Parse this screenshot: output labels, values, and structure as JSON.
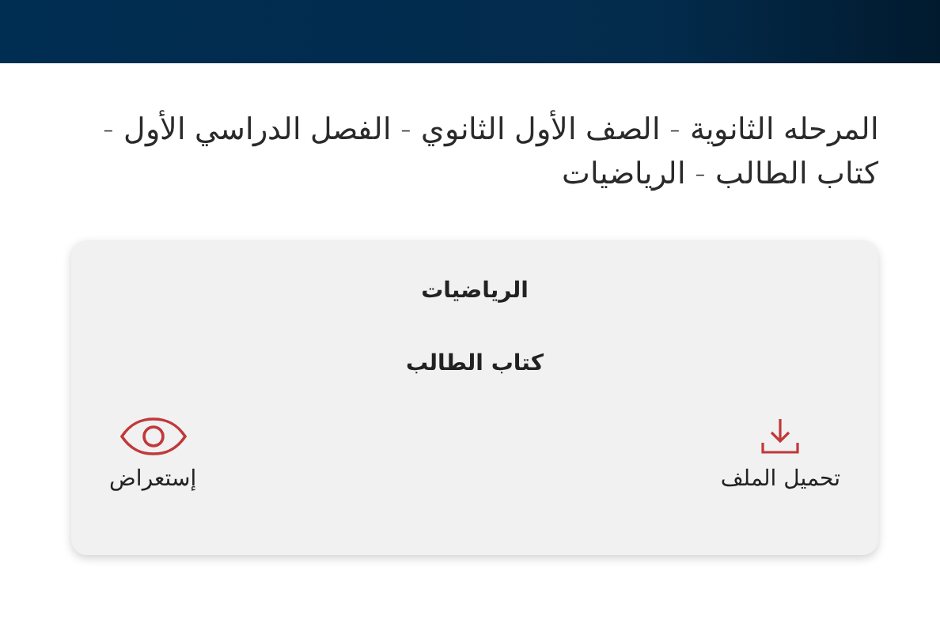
{
  "title": "المرحله الثانوية - الصف الأول الثانوي - الفصل الدراسي الأول - كتاب الطالب - الرياضيات",
  "card": {
    "subject": "الرياضيات",
    "book": "كتاب الطالب",
    "actions": [
      {
        "kind": "download",
        "label": "تحميل الملف"
      },
      {
        "kind": "view",
        "label": "إستعراض"
      }
    ]
  }
}
